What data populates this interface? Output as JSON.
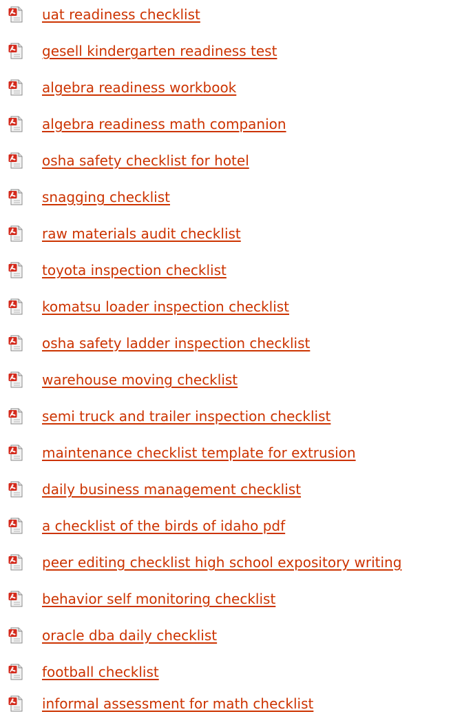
{
  "links": [
    {
      "text": "uat readiness checklist",
      "icon": "pdf-file-icon"
    },
    {
      "text": "gesell kindergarten readiness test",
      "icon": "pdf-file-icon"
    },
    {
      "text": "algebra readiness workbook",
      "icon": "pdf-file-icon"
    },
    {
      "text": "algebra readiness math companion",
      "icon": "pdf-file-icon"
    },
    {
      "text": "osha safety checklist for hotel",
      "icon": "pdf-file-icon"
    },
    {
      "text": "snagging checklist",
      "icon": "pdf-file-icon"
    },
    {
      "text": "raw materials audit checklist",
      "icon": "pdf-file-icon"
    },
    {
      "text": "toyota inspection checklist",
      "icon": "pdf-file-icon"
    },
    {
      "text": "komatsu loader inspection checklist",
      "icon": "pdf-file-icon"
    },
    {
      "text": "osha safety ladder inspection checklist",
      "icon": "pdf-file-icon"
    },
    {
      "text": "warehouse moving checklist",
      "icon": "pdf-file-icon"
    },
    {
      "text": "semi truck and trailer inspection checklist",
      "icon": "pdf-file-icon"
    },
    {
      "text": "maintenance checklist template for extrusion",
      "icon": "pdf-file-icon"
    },
    {
      "text": "daily business management checklist",
      "icon": "pdf-file-icon"
    },
    {
      "text": "a checklist of the birds of idaho pdf",
      "icon": "pdf-file-icon"
    },
    {
      "text": "peer editing checklist high school expository writing",
      "icon": "pdf-file-icon"
    },
    {
      "text": "behavior self monitoring checklist",
      "icon": "pdf-file-icon"
    },
    {
      "text": "oracle dba daily checklist",
      "icon": "pdf-file-icon"
    },
    {
      "text": "football checklist",
      "icon": "pdf-file-icon"
    },
    {
      "text": "informal assessment for math checklist",
      "icon": "pdf-file-icon"
    }
  ],
  "colors": {
    "link": "#cc3300",
    "icon_red": "#d42a1c",
    "icon_page": "#f2f2f2"
  }
}
